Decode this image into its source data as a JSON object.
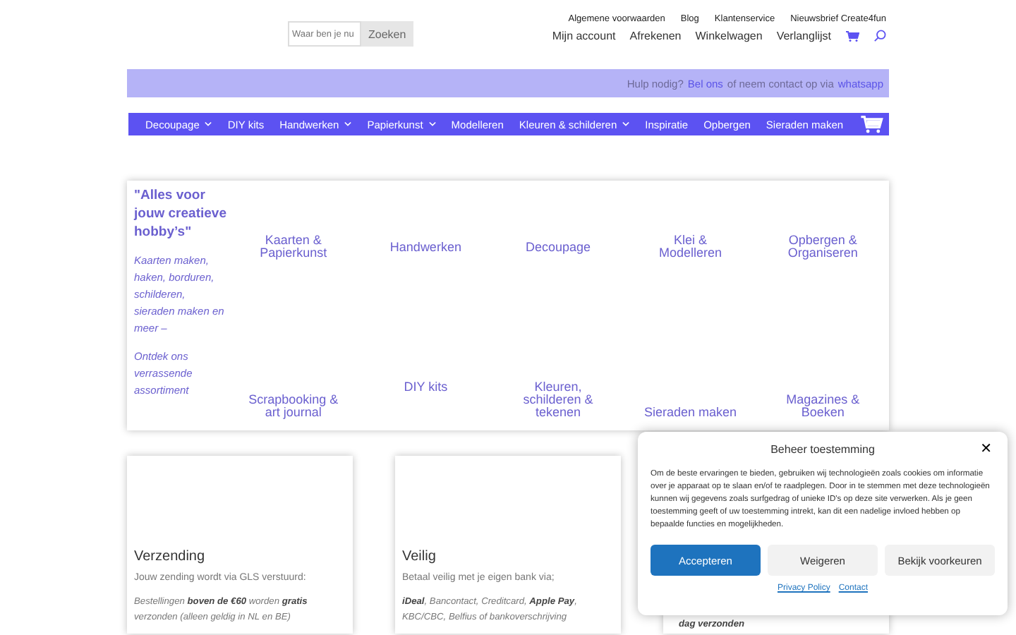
{
  "search": {
    "placeholder": "Waar ben je nu",
    "button": "Zoeken"
  },
  "top_links": [
    "Algemene voorwaarden",
    "Blog",
    "Klantenservice",
    "Nieuwsbrief Create4fun"
  ],
  "account_links": [
    "Mijn account",
    "Afrekenen",
    "Winkelwagen",
    "Verlanglijst"
  ],
  "help_bar": [
    {
      "kind": "text",
      "text": "Hulp nodig?"
    },
    {
      "kind": "link",
      "text": "Bel ons"
    },
    {
      "kind": "text",
      "text": "of neem contact op via"
    },
    {
      "kind": "link",
      "text": "whatsapp"
    }
  ],
  "nav": [
    {
      "label": "Decoupage",
      "dropdown": true
    },
    {
      "label": "DIY kits",
      "dropdown": false
    },
    {
      "label": "Handwerken",
      "dropdown": true
    },
    {
      "label": "Papierkunst",
      "dropdown": true
    },
    {
      "label": "Modelleren",
      "dropdown": false
    },
    {
      "label": "Kleuren & schilderen",
      "dropdown": true
    },
    {
      "label": "Inspiratie",
      "dropdown": false
    },
    {
      "label": "Opbergen",
      "dropdown": false
    },
    {
      "label": "Sieraden maken",
      "dropdown": false
    }
  ],
  "intro": {
    "title": "\"Alles voor jouw creatieve hobby’s\"",
    "text": "Kaarten maken, haken, borduren, schilderen, sieraden maken en meer –",
    "cta": "Ontdek ons verrassende assortiment"
  },
  "categories": [
    "Kaarten & Papierkunst",
    "Handwerken",
    "Decoupage",
    "Klei & Modelleren",
    "Opbergen & Organiseren",
    "Scrapbooking & art journal",
    "DIY kits",
    "Kleuren, schilderen & tekenen",
    "Sieraden maken",
    "Magazines & Boeken"
  ],
  "cards": [
    {
      "title": "Verzending",
      "subtitle": "Jouw zending wordt via GLS verstuurd:",
      "text": "Bestellingen **boven de €60** worden **gratis** verzonden (alleen geldig in NL en BE)"
    },
    {
      "title": "Veilig",
      "subtitle": "Betaal veilig met je eigen bank via;",
      "text": "**iDeal**, Bancontact, Creditcard, **Apple Pay**, KBC/CBC, Belfius of bankoverschrijving"
    },
    {
      "text": "**dag verzonden**"
    }
  ],
  "consent": {
    "title": "Beheer toestemming",
    "close": "✕",
    "text": "Om de beste ervaringen te bieden, gebruiken wij technologieën zoals cookies om informatie over je apparaat op te slaan en/of te raadplegen. Door in te stemmen met deze technologieën kunnen wij gegevens zoals surfgedrag of unieke ID's op deze site verwerken. Als je geen toestemming geeft of uw toestemming intrekt, kan dit een nadelige invloed hebben op bepaalde functies en mogelijkheden.",
    "buttons": [
      {
        "label": "Accepteren",
        "kind": "primary"
      },
      {
        "label": "Weigeren",
        "kind": "secondary"
      },
      {
        "label": "Bekijk voorkeuren",
        "kind": "secondary"
      }
    ],
    "links": [
      "Privacy Policy",
      "Contact"
    ]
  }
}
